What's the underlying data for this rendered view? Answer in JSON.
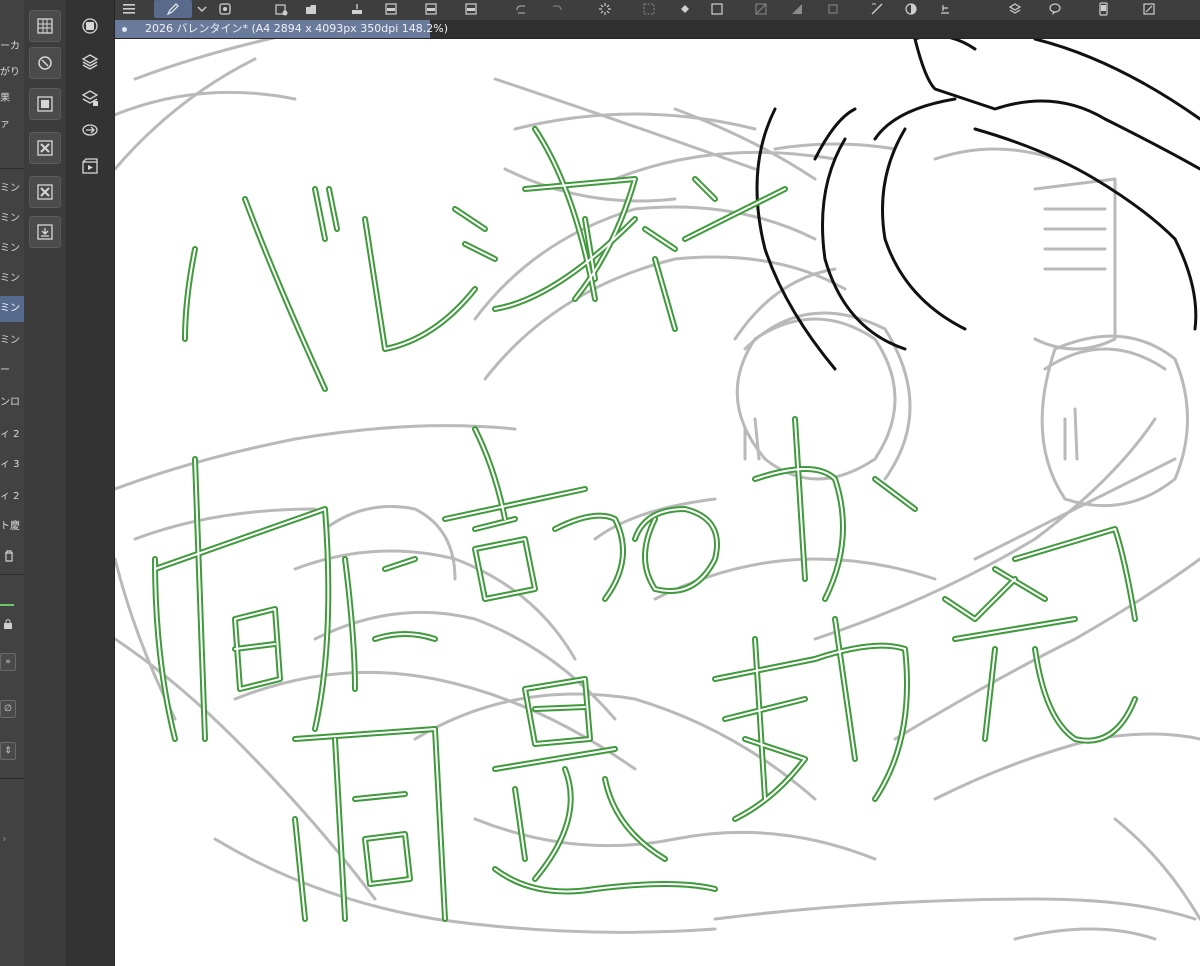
{
  "document_tab": {
    "title": "2026 バレンタイン* (A4 2894 x 4093px 350dpi 148.2%)"
  },
  "left_panel": {
    "top_items": [
      "ーカ",
      "がり",
      "果",
      "ァ"
    ],
    "layers": [
      "ミン",
      "ミン",
      "ミン",
      "ミン",
      "ミン",
      "ミン",
      "ー",
      "ンロ",
      "ィ 2",
      "ィ 3",
      "ィ 2",
      "ト慶"
    ]
  },
  "canvas": {
    "lettering_lines": [
      "バレンタイン",
      "何に合うのか",
      "問題勃発"
    ],
    "lettering_color": "#3f9a3c",
    "sketch_color": "#b9b9b9",
    "lineart_color": "#111111"
  },
  "colors": {
    "accent": "#6a7a9a",
    "selected_layer": "#566a8d"
  },
  "icons": {
    "toolbar": [
      "menu-icon",
      "pen-icon",
      "chevron-down-icon",
      "new-doc-icon",
      "open-icon",
      "save-icon",
      "export-icon",
      "export-jpg-icon",
      "export-png-icon",
      "export-psd-icon",
      "undo-icon",
      "redo-icon",
      "loading-icon",
      "transform-icon",
      "fill-icon",
      "selection-icon",
      "clear-icon",
      "bucket-icon",
      "frame-icon",
      "ruler-icon",
      "contrast-icon",
      "cut-icon",
      "layer-3d-icon",
      "bubble-icon",
      "phone-icon",
      "resize-icon"
    ],
    "strip": [
      "grid-icon",
      "navigator-icon",
      "film-icon",
      "delete-layer-icon",
      "delete-sub-icon",
      "import-icon"
    ],
    "strip2": [
      "circle-button-icon",
      "layers-icon",
      "layer-property-icon",
      "transfer-icon",
      "animation-icon"
    ]
  }
}
